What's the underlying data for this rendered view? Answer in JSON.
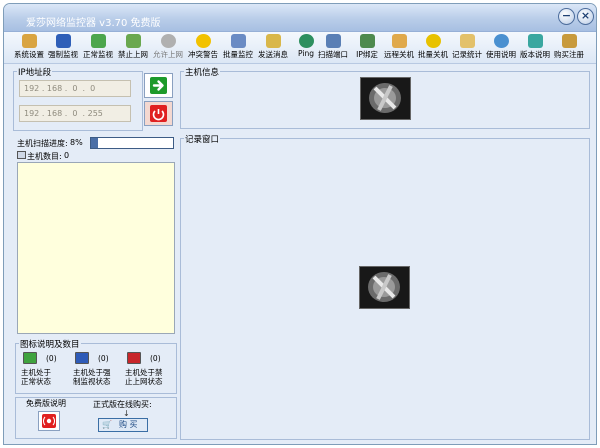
{
  "window": {
    "title": "爱莎网络监控器 v3.70 免费版",
    "minimize_glyph": "−",
    "close_glyph": "×"
  },
  "toolbar": {
    "items": [
      {
        "label": "系统设置",
        "icon": "gear-icon",
        "color": "#d9a441"
      },
      {
        "label": "强制监视",
        "icon": "monitor-icon",
        "color": "#2f5fb8"
      },
      {
        "label": "正常监视",
        "icon": "monitor-icon",
        "color": "#4ca64c"
      },
      {
        "label": "禁止上网",
        "icon": "block-icon",
        "color": "#6aa84f"
      },
      {
        "label": "允许上网",
        "icon": "allow-icon",
        "color": "#b0b0b0"
      },
      {
        "label": "冲突警告",
        "icon": "warning-icon",
        "color": "#f2c200"
      },
      {
        "label": "批量监控",
        "icon": "batch-monitor-icon",
        "color": "#6a8bc4"
      },
      {
        "label": "发送消息",
        "icon": "message-icon",
        "color": "#d9b74a"
      },
      {
        "label": "Ping",
        "icon": "ping-icon",
        "color": "#2d8f5f"
      },
      {
        "label": "扫描端口",
        "icon": "scan-port-icon",
        "color": "#5a7fb5"
      },
      {
        "label": "IP绑定",
        "icon": "ip-bind-icon",
        "color": "#4e8a4e"
      },
      {
        "label": "远程关机",
        "icon": "remote-shutdown-icon",
        "color": "#e0a94b"
      },
      {
        "label": "批量关机",
        "icon": "radiation-icon",
        "color": "#e8c200"
      },
      {
        "label": "记录统计",
        "icon": "folder-icon",
        "color": "#e3c16a"
      },
      {
        "label": "使用说明",
        "icon": "help-icon",
        "color": "#4a90d0"
      },
      {
        "label": "版本说明",
        "icon": "version-icon",
        "color": "#3aa7a0"
      },
      {
        "label": "购买注册",
        "icon": "register-icon",
        "color": "#c89a3c"
      }
    ]
  },
  "ip_group": {
    "title": "IP地址段",
    "start_ip": "192 . 168 .  0  .  0",
    "end_ip": "192 . 168 .  0  . 255"
  },
  "scan": {
    "label": "主机扫描进度:",
    "percent_text": "8%",
    "progress": 0.08
  },
  "host_count": {
    "label": "主机数目:",
    "value": "0"
  },
  "legend": {
    "title": "图标说明及数目",
    "items": [
      {
        "count": "(0)",
        "label_line1": "主机处于",
        "label_line2": "正常状态",
        "color": "#3fa33f"
      },
      {
        "count": "(0)",
        "label_line1": "主机处于强",
        "label_line2": "制监视状态",
        "color": "#2e5bb8"
      },
      {
        "count": "(0)",
        "label_line1": "主机处于禁",
        "label_line2": "止上网状态",
        "color": "#c8262b"
      }
    ]
  },
  "bottom": {
    "free_notice_label": "免费版说明",
    "buy_notice_label": "正式版在线购买:",
    "buy_button_label": "购 买"
  },
  "host_info": {
    "title": "主机信息"
  },
  "record_window": {
    "title": "记录窗口"
  },
  "colors": {
    "accent_green": "#1d9a2a",
    "alert_red": "#e02020"
  }
}
